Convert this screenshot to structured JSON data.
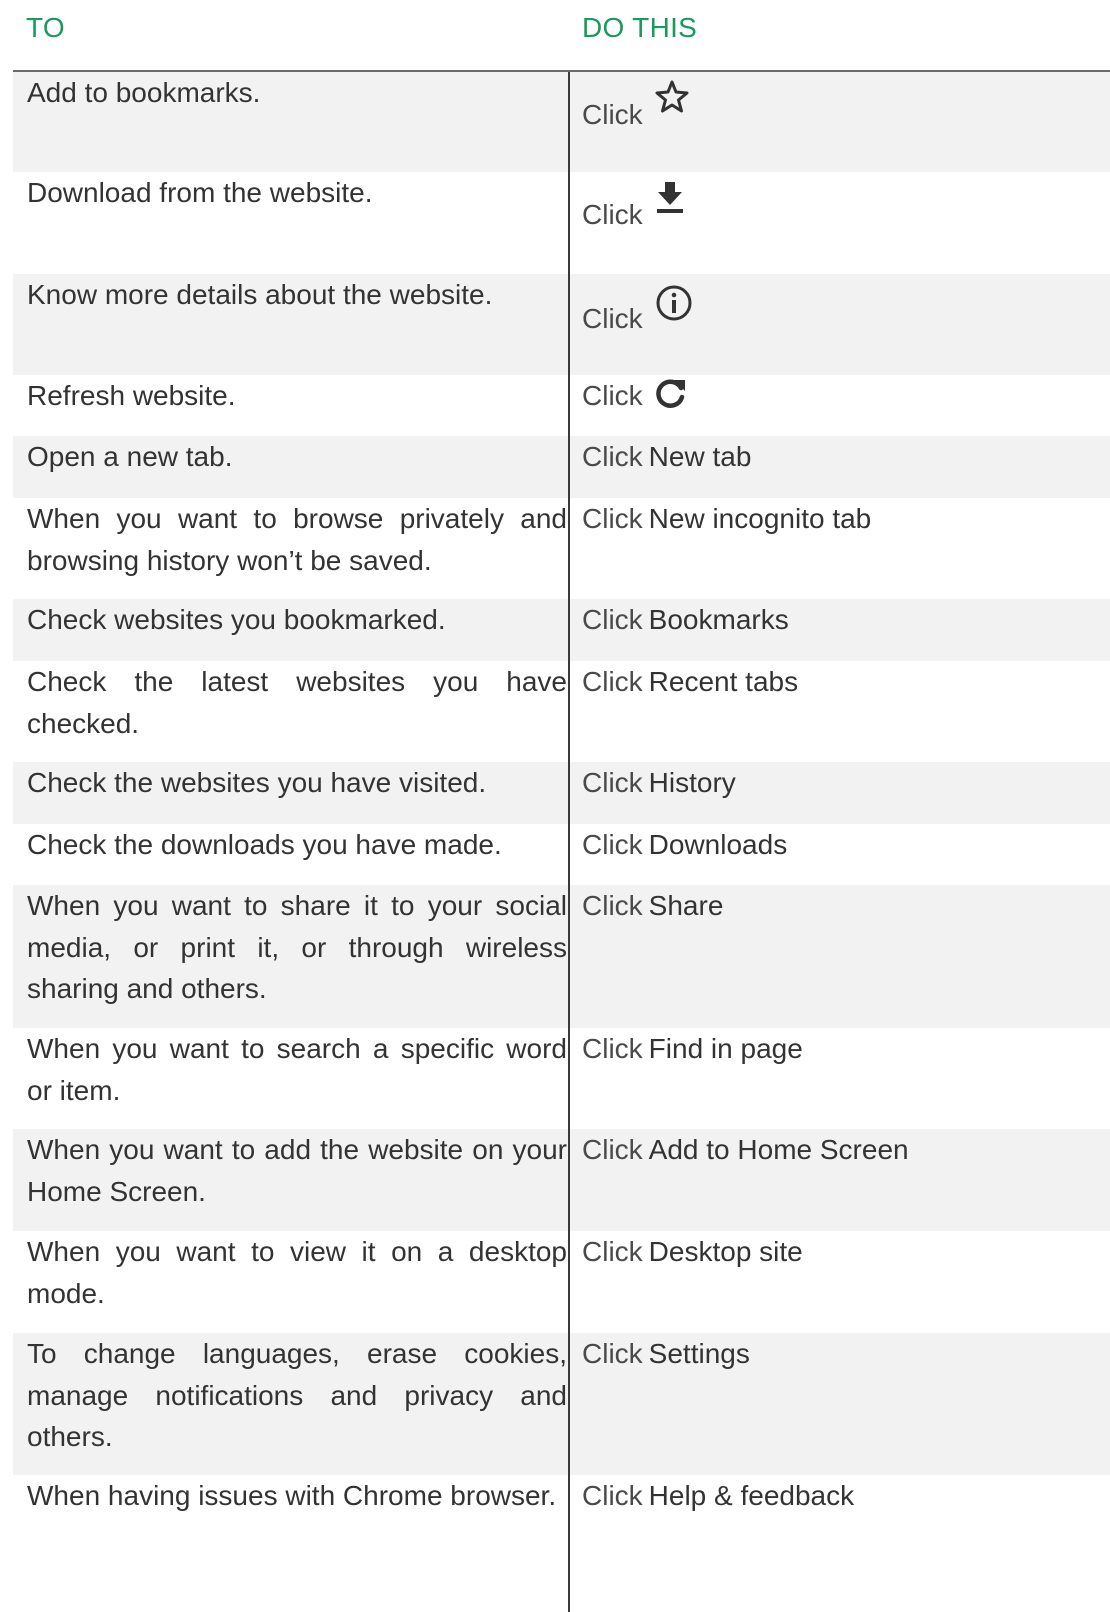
{
  "header": {
    "to": "TO",
    "do_this": "DO THIS"
  },
  "rows": [
    {
      "to": "Add to bookmarks.",
      "click": "Click",
      "action": "",
      "icon": "star-outline-icon"
    },
    {
      "to": "Download from the website.",
      "click": "Click",
      "action": "",
      "icon": "download-icon"
    },
    {
      "to": "Know more details about the website.",
      "click": "Click",
      "action": "",
      "icon": "info-icon"
    },
    {
      "to": "Refresh website.",
      "click": "Click",
      "action": "",
      "icon": "refresh-icon"
    },
    {
      "to": "Open a new tab.",
      "click": "Click",
      "action": "New tab"
    },
    {
      "to": "When you want to browse privately and browsing history won’t be saved.",
      "click": "Click",
      "action": "New incognito tab"
    },
    {
      "to": "Check websites you bookmarked.",
      "click": "Click",
      "action": "Bookmarks"
    },
    {
      "to": "Check the latest websites you have checked.",
      "click": "Click",
      "action": "Recent tabs"
    },
    {
      "to": "Check the websites you have visited.",
      "click": "Click",
      "action": "History"
    },
    {
      "to": "Check the downloads you have made.",
      "click": "Click",
      "action": "Downloads"
    },
    {
      "to": "When you want to share it to your social media, or print it, or through wireless sharing and others.",
      "click": "Click",
      "action": "Share"
    },
    {
      "to": "When you want to search a specific word or item.",
      "click": "Click",
      "action": "Find in page"
    },
    {
      "to": "When you want to add the website on your Home Screen.",
      "click": "Click",
      "action": "Add to Home Screen"
    },
    {
      "to": "When you want to view it on a desktop mode.",
      "click": "Click",
      "action": "Desktop site"
    },
    {
      "to": "To change languages, erase cookies, manage notifications and privacy and others.",
      "click": "Click",
      "action": "Settings"
    },
    {
      "to": "When having issues with Chrome browser.",
      "click": "Click",
      "action": "Help & feedback"
    }
  ]
}
